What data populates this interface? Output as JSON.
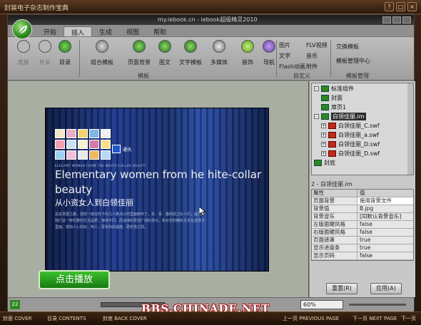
{
  "frame": {
    "title": "封装电子杂志制作宝典",
    "controls": [
      "?",
      "□",
      "×"
    ]
  },
  "window": {
    "title": "my.iebook.cn - iebook超级精灵2010"
  },
  "tabs": [
    {
      "label": "开始",
      "active": false
    },
    {
      "label": "插入",
      "active": true
    },
    {
      "label": "生成",
      "active": false
    },
    {
      "label": "视图",
      "active": false
    },
    {
      "label": "帮助",
      "active": false
    }
  ],
  "ribbon": {
    "buttons": [
      {
        "label": "皮肤",
        "dim": true
      },
      {
        "label": "片头",
        "dim": true
      },
      {
        "label": "目录",
        "dim": false
      },
      {
        "label": "组合模板",
        "dim": false
      },
      {
        "label": "页面背景",
        "dim": false
      },
      {
        "label": "图文",
        "dim": false
      },
      {
        "label": "文字模板",
        "dim": false
      },
      {
        "label": "多媒体",
        "dim": false
      },
      {
        "label": "装饰",
        "dim": false
      },
      {
        "label": "导航",
        "dim": false
      }
    ],
    "custom_items": [
      "图片",
      "FLV视频",
      "文字",
      "音乐",
      "Flash动画",
      "附件"
    ],
    "template_items": [
      "交换模板",
      "模板管理中心"
    ],
    "group_labels": {
      "templates": "模板",
      "custom": "自定义",
      "template_mgmt": "模板管理"
    }
  },
  "canvas": {
    "magazine": {
      "logo_text": "通讯",
      "tagline": "ELEGANT WOMEN FROM THE WHITE-COLLAR BEAUTY",
      "title_en": "Elementary women from he hite-collar beauty",
      "title_cn": "从小资女人到白领佳丽",
      "paragraph": "这是发展之路，曾经一度在时下的几人焦点公司里面制作了，年、青、春的前卫女人们，提供给她们这一种优雅的生活品质，使得不同，原话得的更加广阔的多元，和女性的精彩文化在这样子里面，感动人心的好，知人，更实际的温度，更珍惜之情。"
    },
    "play_button": "点击播放"
  },
  "tree": {
    "items": [
      {
        "label": "标准组件",
        "type": "page",
        "expand": "-",
        "indent": 0
      },
      {
        "label": "封面",
        "type": "page",
        "expand": "",
        "indent": 1
      },
      {
        "label": "扉页1",
        "type": "page",
        "expand": "",
        "indent": 1
      },
      {
        "label": "白领佳丽.im",
        "type": "page",
        "expand": "-",
        "indent": 0,
        "selected": true
      },
      {
        "label": "白领佳丽_C.swf",
        "type": "pdf",
        "expand": "+",
        "indent": 1
      },
      {
        "label": "白领佳丽_a.swf",
        "type": "pdf",
        "expand": "+",
        "indent": 1
      },
      {
        "label": "白领佳丽_D.swf",
        "type": "pdf",
        "expand": "+",
        "indent": 1
      },
      {
        "label": "白领佳丽_D.swf",
        "type": "pdf",
        "expand": "+",
        "indent": 1
      },
      {
        "label": "封底",
        "type": "page",
        "expand": "",
        "indent": 0
      }
    ]
  },
  "properties": {
    "title": "2 - 白领佳丽.im",
    "header": {
      "key": "属性",
      "value": "值"
    },
    "rows": [
      {
        "key": "页面背景",
        "value": "使用背景文件",
        "dropdown": true
      },
      {
        "key": "背景值",
        "value": "B.jpg"
      },
      {
        "key": "背景音乐",
        "value": "[同默认背景音乐]"
      },
      {
        "key": "左版面硬风格",
        "value": "false"
      },
      {
        "key": "右版面硬风格",
        "value": "false"
      },
      {
        "key": "页面遮罩",
        "value": "true"
      },
      {
        "key": "显示进度条",
        "value": "true"
      },
      {
        "key": "显示页码",
        "value": "false"
      }
    ],
    "reset_label": "重置(R)",
    "apply_label": "应用(A)"
  },
  "statusbar": {
    "page_badge": "22",
    "zoom": "60%"
  },
  "navbar": {
    "items": [
      "封面 COVER",
      "目录 CONTENTS",
      "封底 BACK COVER",
      "上一页 PREVIOUS PAGE",
      "下一页 NEXT PAGE",
      "下一页"
    ]
  },
  "watermark": "BBS.CHINADE.NET"
}
